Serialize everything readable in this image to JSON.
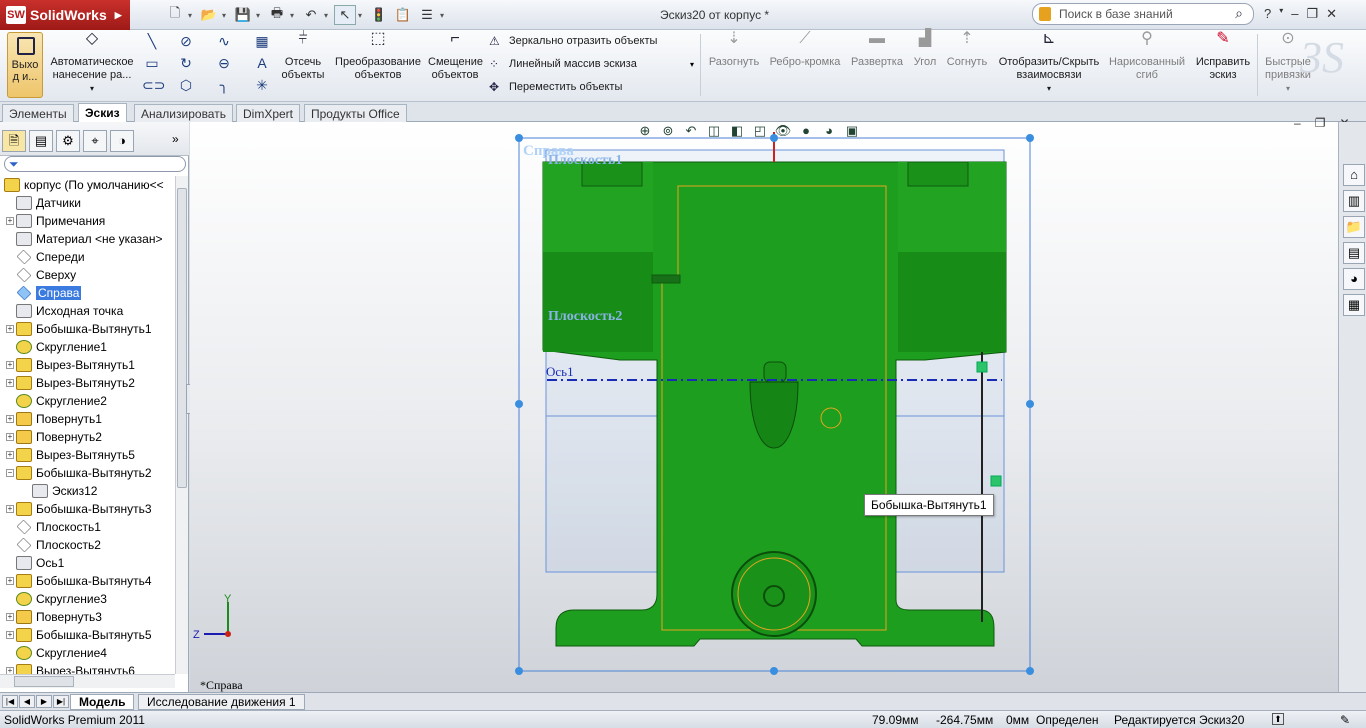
{
  "app": {
    "logo": "SolidWorks",
    "logo_short": "SW",
    "window_title": "Эскиз20 от корпус *"
  },
  "search": {
    "placeholder": "Поиск в базе знаний"
  },
  "window_controls": [
    "?",
    "–",
    "❐",
    "✕"
  ],
  "ribbon": {
    "exit_sketch": "Выхо д и...",
    "auto_dimension": "Автоматическое нанесение ра...",
    "trim": "Отсечь объекты",
    "convert": "Преобразование объектов",
    "offset": "Смещение объектов",
    "mirror": "Зеркально отразить объекты",
    "linear_pattern": "Линейный массив эскиза",
    "move": "Переместить объекты",
    "unfold": "Разогнуть",
    "edge_flange": "Ребро-кромка",
    "flatten": "Развертка",
    "angle": "Угол",
    "bend": "Согнуть",
    "show_relations": "Отобразить/Скрыть взаимосвязи",
    "sketched_bend": "Нарисованный сгиб",
    "repair_sketch": "Исправить эскиз",
    "quick_snaps": "Быстрые привязки"
  },
  "tabs": [
    "Элементы",
    "Эскиз",
    "Анализировать",
    "DimXpert",
    "Продукты Office"
  ],
  "active_tab": "Эскиз",
  "feature_tree": {
    "root": "корпус  (По умолчанию<<",
    "items": [
      {
        "label": "Датчики",
        "icon": "sensor-icon",
        "expand": ""
      },
      {
        "label": "Примечания",
        "icon": "annotation-icon",
        "expand": "+"
      },
      {
        "label": "Материал <не указан>",
        "icon": "material-icon",
        "expand": ""
      },
      {
        "label": "Спереди",
        "icon": "plane-icon",
        "expand": ""
      },
      {
        "label": "Сверху",
        "icon": "plane-icon",
        "expand": ""
      },
      {
        "label": "Справа",
        "icon": "plane-icon",
        "expand": "",
        "selected": true
      },
      {
        "label": "Исходная точка",
        "icon": "origin-icon",
        "expand": ""
      },
      {
        "label": "Бобышка-Вытянуть1",
        "icon": "extrude-icon",
        "expand": "+"
      },
      {
        "label": "Скругление1",
        "icon": "fillet-icon",
        "expand": ""
      },
      {
        "label": "Вырез-Вытянуть1",
        "icon": "cut-icon",
        "expand": "+"
      },
      {
        "label": "Вырез-Вытянуть2",
        "icon": "cut-icon",
        "expand": "+"
      },
      {
        "label": "Скругление2",
        "icon": "fillet-icon",
        "expand": ""
      },
      {
        "label": "Повернуть1",
        "icon": "revolve-icon",
        "expand": "+"
      },
      {
        "label": "Повернуть2",
        "icon": "revolve-icon",
        "expand": "+"
      },
      {
        "label": "Вырез-Вытянуть5",
        "icon": "cut-icon",
        "expand": "+"
      },
      {
        "label": "Бобышка-Вытянуть2",
        "icon": "extrude-icon",
        "expand": "−"
      },
      {
        "label": "Эскиз12",
        "icon": "sketch-icon",
        "expand": "",
        "indent": true
      },
      {
        "label": "Бобышка-Вытянуть3",
        "icon": "extrude-icon",
        "expand": "+"
      },
      {
        "label": "Плоскость1",
        "icon": "plane-icon",
        "expand": ""
      },
      {
        "label": "Плоскость2",
        "icon": "plane-icon",
        "expand": ""
      },
      {
        "label": "Ось1",
        "icon": "axis-icon",
        "expand": ""
      },
      {
        "label": "Бобышка-Вытянуть4",
        "icon": "extrude-icon",
        "expand": "+"
      },
      {
        "label": "Скругление3",
        "icon": "fillet-icon",
        "expand": ""
      },
      {
        "label": "Повернуть3",
        "icon": "revolve-icon",
        "expand": "+"
      },
      {
        "label": "Бобышка-Вытянуть5",
        "icon": "extrude-icon",
        "expand": "+"
      },
      {
        "label": "Скругление4",
        "icon": "fillet-icon",
        "expand": ""
      },
      {
        "label": "Вырез-Вытянуть6",
        "icon": "cut-icon",
        "expand": "+"
      }
    ]
  },
  "viewport": {
    "view_label": "Справа",
    "plane1": "Плоскость1",
    "plane2": "Плоскость2",
    "axis1": "Ось1",
    "tooltip": "Бобышка-Вытянуть1",
    "view_name": "*Справа",
    "triad_y": "Y",
    "triad_z": "Z"
  },
  "bottom_tabs": [
    "Модель",
    "Исследование движения 1"
  ],
  "status": {
    "product": "SolidWorks Premium 2011",
    "x": "79.09мм",
    "y": "-264.75мм",
    "z": "0мм",
    "state": "Определен",
    "editing": "Редактируется Эскиз20"
  },
  "colors": {
    "part": "#1e9e1e",
    "part_dark": "#137513",
    "selection": "#3b7be0",
    "axis": "#1a2bb8"
  }
}
